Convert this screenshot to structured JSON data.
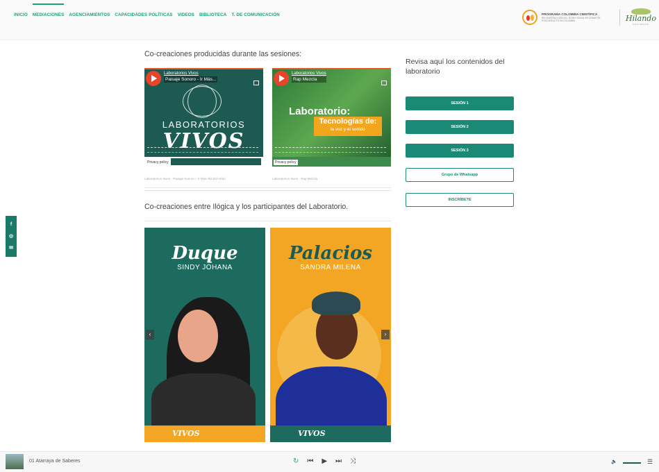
{
  "nav": {
    "items": [
      "INICIO",
      "MEDIACIONES",
      "AGENCIAMIENTOS",
      "CAPACIDADES POLÍTICAS",
      "VIDEOS",
      "BIBLIOTECA",
      "T. DE COMUNICACIÓN"
    ],
    "active": "MEDIACIONES"
  },
  "brand": {
    "program": "PROGRAMA COLOMBIA CIENTÍFICA",
    "program_sub": "RECONSTRUCCIÓN DEL TEJIDO SOCIAL EN ZONAS DE POSCONFLICTO EN COLOMBIA",
    "partner": "Hilando",
    "partner_sub": "SOCIEDAD"
  },
  "social": {
    "icons": [
      "facebook-icon",
      "instagram-icon",
      "email-icon"
    ],
    "glyphs": [
      "f",
      "◎",
      "✉"
    ]
  },
  "section1": {
    "title": "Co-creaciones producidas durante las sesiones:",
    "videos": [
      {
        "channel": "Laboratorios Vivos",
        "title": "Paisaje Sonoro - Ir Más...",
        "big1": "LABORATORIOS",
        "big2": "VIVOS",
        "privacy": "Privacy policy",
        "caption": "Laboratorios Vivos · Paisaje Sonoro – Ir Más Allá Del Oído"
      },
      {
        "channel": "Laboratorios Vivos",
        "title": "Rap Mezcla",
        "lab": "Laboratorio:",
        "box_title": "Tecnologías de:",
        "box_sub": "la voz y el sonido",
        "privacy": "Privacy policy",
        "caption": "Laboratorios Vivos · Rap Mezcla"
      }
    ]
  },
  "section2": {
    "title": "Co-creaciones entre Ilógica y los participantes del Laboratorio.",
    "posters": [
      {
        "name": "Duque",
        "sub": "SINDY JOHANA",
        "footer": "VIVOS"
      },
      {
        "name": "Palacios",
        "sub": "SANDRA MILENA",
        "footer": "VIVOS"
      }
    ],
    "prev": "‹",
    "next": "›"
  },
  "sidebar": {
    "title": "Revisa aquí los contenidos del laboratorio",
    "buttons": [
      "SESIÓN 1",
      "SESIÓN 2",
      "SESIÓN 3",
      "Grupo de Whatsapp",
      "INSCRÍBETE"
    ]
  },
  "player": {
    "track": "01 Atarraya de Saberes",
    "controls": {
      "repeat": "↻",
      "prev": "⏮",
      "play": "▶",
      "next": "⏭",
      "shuffle": "⤨"
    },
    "volume_icon": "🔈",
    "menu_icon": "☰"
  },
  "colors": {
    "accent": "#1aa07c",
    "button": "#1a8a77",
    "poster_green": "#1d6b5e",
    "poster_orange": "#f2a623"
  }
}
